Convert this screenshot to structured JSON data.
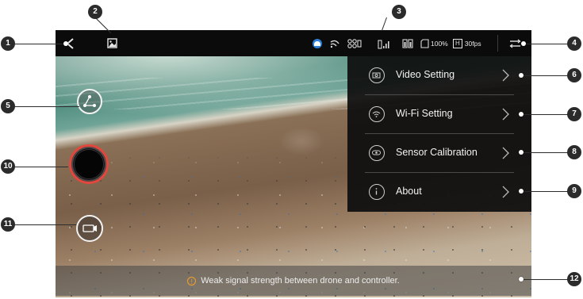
{
  "status": {
    "battery": "100%",
    "resolution_badge": "H",
    "framerate": "30fps"
  },
  "menu": {
    "items": [
      {
        "label": "Video Setting",
        "icon": "camera-icon"
      },
      {
        "label": "Wi-Fi Setting",
        "icon": "wifi-icon"
      },
      {
        "label": "Sensor Calibration",
        "icon": "sensor-icon"
      },
      {
        "label": "About",
        "icon": "info-icon"
      }
    ]
  },
  "notice": {
    "text": "Weak signal strength between drone and controller."
  },
  "callouts": [
    "1",
    "2",
    "3",
    "4",
    "5",
    "6",
    "7",
    "8",
    "9",
    "10",
    "11",
    "12"
  ],
  "colors": {
    "record_ring": "#e2473d",
    "warning": "#f1a02a",
    "callout": "#2b2b2b",
    "topbar": "#0b0b0b"
  }
}
